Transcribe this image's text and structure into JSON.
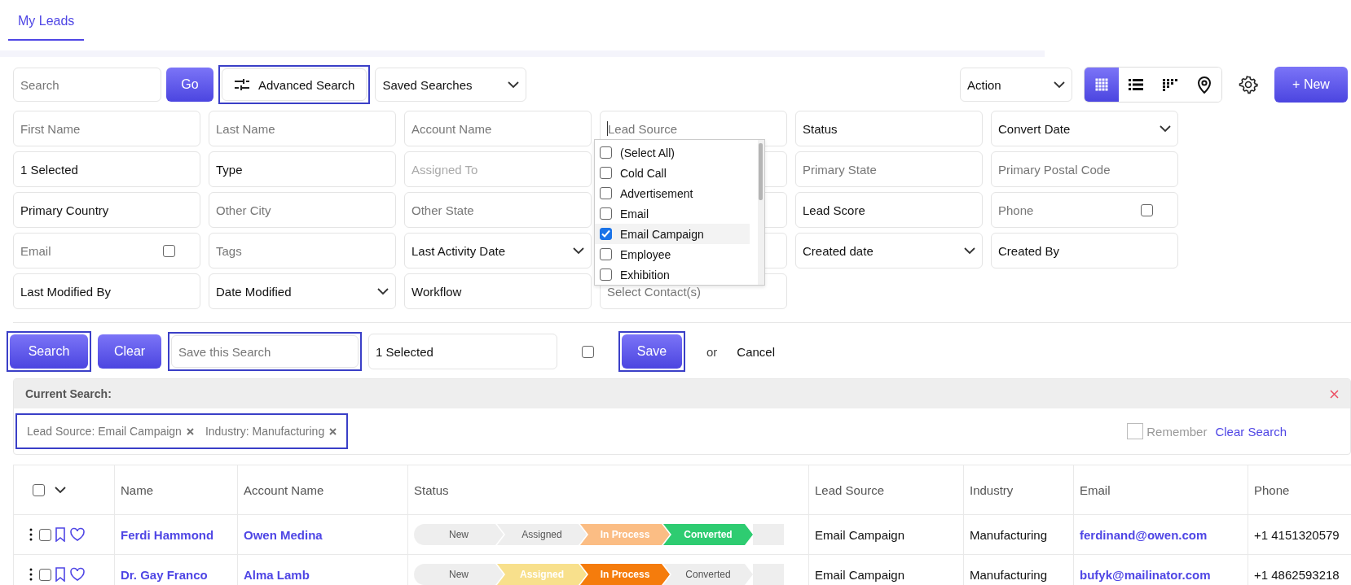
{
  "tabs": [
    {
      "label": "My Leads",
      "selected": true
    }
  ],
  "toolbar": {
    "search": {
      "placeholder": "Search"
    },
    "go": "Go",
    "advanced_search": {
      "label": "Advanced Search",
      "highlighted": true
    },
    "saved_searches": "Saved Searches",
    "action": "Action",
    "views": [
      {
        "kind": "grid",
        "selected": true
      },
      {
        "kind": "list",
        "selected": false
      },
      {
        "kind": "kanban",
        "selected": false
      },
      {
        "kind": "map",
        "selected": false
      }
    ],
    "new_button": "+ New"
  },
  "filters": [
    [
      {
        "kind": "text",
        "placeholder": "First Name"
      },
      {
        "kind": "text",
        "placeholder": "Last Name"
      },
      {
        "kind": "text",
        "placeholder": "Account Name"
      },
      {
        "kind": "text",
        "placeholder": "Lead Source",
        "focused": true
      },
      {
        "kind": "text",
        "value": "Status"
      },
      {
        "kind": "select",
        "value": "Convert Date"
      }
    ],
    [
      {
        "kind": "text",
        "value": "1 Selected"
      },
      {
        "kind": "text",
        "value": "Type"
      },
      {
        "kind": "text",
        "placeholder": "Assigned To",
        "disabled": true
      },
      {
        "kind": "blank"
      },
      {
        "kind": "text",
        "placeholder": "Primary State"
      },
      {
        "kind": "text",
        "placeholder": "Primary Postal Code"
      }
    ],
    [
      {
        "kind": "text",
        "value": "Primary Country"
      },
      {
        "kind": "text",
        "placeholder": "Other City"
      },
      {
        "kind": "text",
        "placeholder": "Other State"
      },
      {
        "kind": "blank"
      },
      {
        "kind": "text",
        "value": "Lead Score"
      },
      {
        "kind": "check",
        "placeholder": "Phone",
        "checked": false
      }
    ],
    [
      {
        "kind": "check",
        "placeholder": "Email",
        "checked": false
      },
      {
        "kind": "text",
        "placeholder": "Tags"
      },
      {
        "kind": "select",
        "value": "Last Activity Date"
      },
      {
        "kind": "blank"
      },
      {
        "kind": "select",
        "value": "Created date"
      },
      {
        "kind": "text",
        "value": "Created By"
      }
    ],
    [
      {
        "kind": "text",
        "value": "Last Modified By"
      },
      {
        "kind": "select",
        "value": "Date Modified"
      },
      {
        "kind": "text",
        "value": "Workflow"
      },
      {
        "kind": "text",
        "placeholder": "Select Contact(s)"
      }
    ]
  ],
  "dropdown": {
    "items": [
      {
        "label": "(Select All)",
        "checked": false
      },
      {
        "label": "Cold Call",
        "checked": false
      },
      {
        "label": "Advertisement",
        "checked": false
      },
      {
        "label": "Email",
        "checked": false
      },
      {
        "label": "Email Campaign",
        "checked": true
      },
      {
        "label": "Employee",
        "checked": false
      },
      {
        "label": "Exhibition",
        "checked": false
      }
    ]
  },
  "actions": {
    "search": {
      "label": "Search",
      "highlighted": true
    },
    "clear": "Clear",
    "save_name": {
      "placeholder": "Save this Search",
      "highlighted": true
    },
    "selected": "1 Selected",
    "checkbox": {
      "checked": false
    },
    "save": {
      "label": "Save",
      "highlighted": true
    },
    "or": "or",
    "cancel": "Cancel"
  },
  "current_search": {
    "title": "Current Search:",
    "tags_highlighted": true,
    "tags": [
      "Lead Source: Email Campaign",
      "Industry: Manufacturing"
    ],
    "remember": {
      "label": "Remember",
      "checked": false
    },
    "clear_link": "Clear Search"
  },
  "table": {
    "select_all": {
      "checked": false
    },
    "columns": [
      "Name",
      "Account Name",
      "Status",
      "Lead Source",
      "Industry",
      "Email",
      "Phone"
    ],
    "rows": [
      {
        "checked": false,
        "name": "Ferdi Hammond",
        "account": "Owen Medina",
        "stages": [
          {
            "label": "New",
            "completed": false,
            "color": "#eeeeee"
          },
          {
            "label": "Assigned",
            "completed": false,
            "color": "#eeeeee"
          },
          {
            "label": "In Process",
            "completed": true,
            "color": "#fbbd84"
          },
          {
            "label": "Converted",
            "completed": true,
            "color": "#2ecc71"
          }
        ],
        "lead_source": "Email Campaign",
        "industry": "Manufacturing",
        "email": "ferdinand@owen.com",
        "phone": "+1 4151320579"
      },
      {
        "checked": false,
        "name": "Dr. Gay Franco",
        "account": "Alma Lamb",
        "stages": [
          {
            "label": "New",
            "completed": false,
            "color": "#eeeeee"
          },
          {
            "label": "Assigned",
            "completed": true,
            "color": "#f8e08c"
          },
          {
            "label": "In Process",
            "completed": true,
            "color": "#f57c0c"
          },
          {
            "label": "Converted",
            "completed": false,
            "color": "#eeeeee"
          }
        ],
        "lead_source": "Email Campaign",
        "industry": "Manufacturing",
        "email": "bufyk@mailinator.com",
        "phone": "+1 4862593218"
      }
    ]
  }
}
